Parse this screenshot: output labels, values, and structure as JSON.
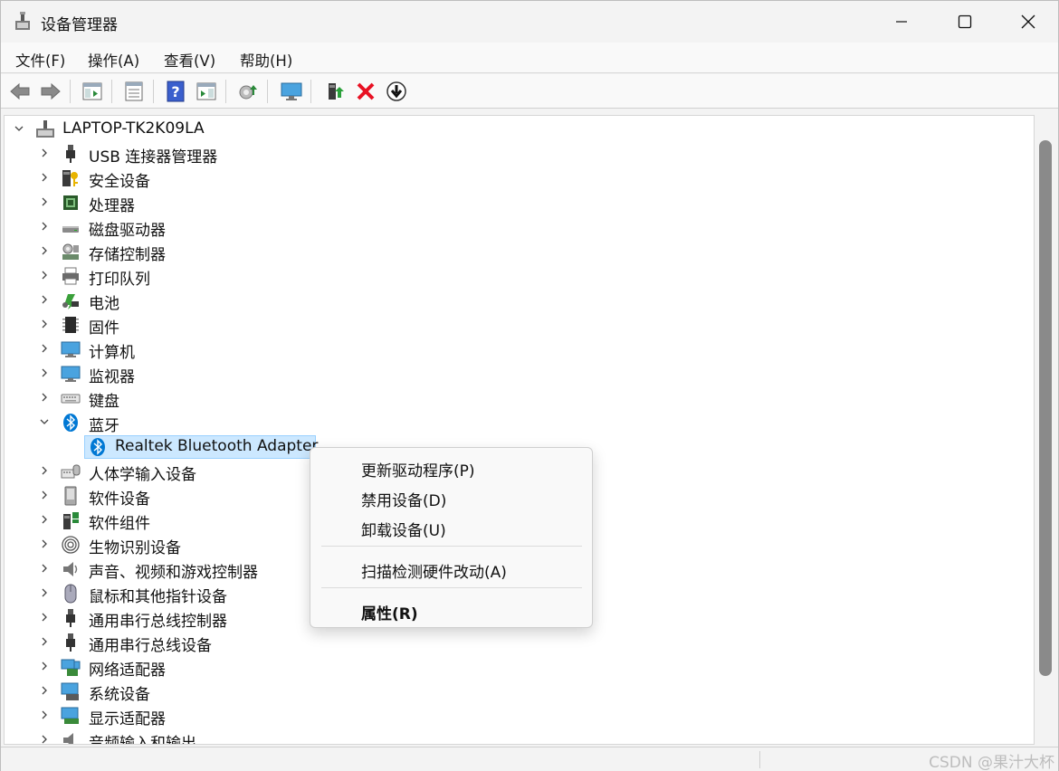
{
  "window": {
    "title": "设备管理器",
    "controls": [
      "minimize-icon",
      "maximize-icon",
      "close-icon"
    ]
  },
  "menubar": {
    "items": [
      {
        "label": "文件(F)"
      },
      {
        "label": "操作(A)"
      },
      {
        "label": "查看(V)"
      },
      {
        "label": "帮助(H)"
      }
    ]
  },
  "toolbar": {
    "buttons": [
      "back-arrow-icon",
      "forward-arrow-icon",
      "show-hide-console-tree-icon",
      "properties-icon",
      "help-icon",
      "action-pane-icon",
      "scan-hardware-icon",
      "monitor-icon",
      "update-driver-icon",
      "uninstall-device-icon",
      "disable-device-icon"
    ]
  },
  "tree": {
    "root": {
      "label": "LAPTOP-TK2K09LA",
      "expanded": true
    },
    "items": [
      {
        "label": "USB 连接器管理器",
        "icon": "usb-connector-icon",
        "expanded": false
      },
      {
        "label": "安全设备",
        "icon": "security-device-icon",
        "expanded": false
      },
      {
        "label": "处理器",
        "icon": "processor-icon",
        "expanded": false
      },
      {
        "label": "磁盘驱动器",
        "icon": "disk-drive-icon",
        "expanded": false
      },
      {
        "label": "存储控制器",
        "icon": "storage-controller-icon",
        "expanded": false
      },
      {
        "label": "打印队列",
        "icon": "printer-icon",
        "expanded": false
      },
      {
        "label": "电池",
        "icon": "battery-icon",
        "expanded": false
      },
      {
        "label": "固件",
        "icon": "firmware-icon",
        "expanded": false
      },
      {
        "label": "计算机",
        "icon": "computer-icon",
        "expanded": false
      },
      {
        "label": "监视器",
        "icon": "monitor-icon",
        "expanded": false
      },
      {
        "label": "键盘",
        "icon": "keyboard-icon",
        "expanded": false
      },
      {
        "label": "蓝牙",
        "icon": "bluetooth-icon",
        "expanded": true,
        "children": [
          {
            "label": "Realtek Bluetooth Adapter",
            "icon": "bluetooth-icon",
            "selected": true
          }
        ]
      },
      {
        "label": "人体学输入设备",
        "icon": "hid-icon",
        "expanded": false
      },
      {
        "label": "软件设备",
        "icon": "software-device-icon",
        "expanded": false
      },
      {
        "label": "软件组件",
        "icon": "software-component-icon",
        "expanded": false
      },
      {
        "label": "生物识别设备",
        "icon": "fingerprint-icon",
        "expanded": false
      },
      {
        "label": "声音、视频和游戏控制器",
        "icon": "speaker-icon",
        "expanded": false
      },
      {
        "label": "鼠标和其他指针设备",
        "icon": "mouse-icon",
        "expanded": false
      },
      {
        "label": "通用串行总线控制器",
        "icon": "usb-icon",
        "expanded": false
      },
      {
        "label": "通用串行总线设备",
        "icon": "usb-icon",
        "expanded": false
      },
      {
        "label": "网络适配器",
        "icon": "network-adapter-icon",
        "expanded": false
      },
      {
        "label": "系统设备",
        "icon": "system-device-icon",
        "expanded": false
      },
      {
        "label": "显示适配器",
        "icon": "display-adapter-icon",
        "expanded": false
      },
      {
        "label": "音频输入和输出",
        "icon": "audio-io-icon",
        "expanded": false
      }
    ]
  },
  "context_menu": {
    "items": [
      {
        "label": "更新驱动程序(P)"
      },
      {
        "label": "禁用设备(D)"
      },
      {
        "label": "卸载设备(U)"
      },
      {
        "label": "扫描检测硬件改动(A)"
      },
      {
        "label": "属性(R)",
        "bold": true
      }
    ]
  },
  "watermark": "CSDN @果汁大杯",
  "colors": {
    "selection": "#cce8ff",
    "selection_border": "#99d1ff",
    "bluetooth_blue": "#0078d4",
    "delete_red": "#e81123"
  }
}
